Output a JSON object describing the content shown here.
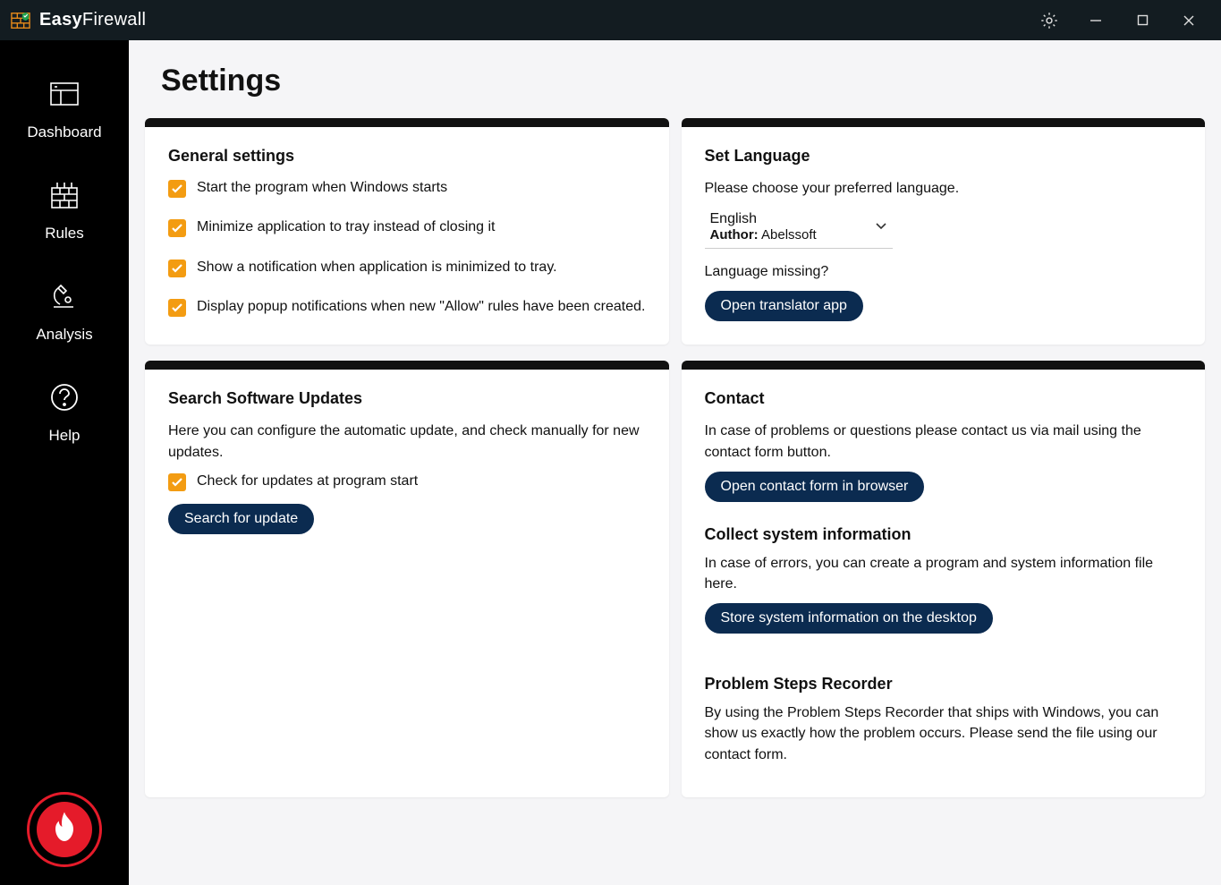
{
  "titlebar": {
    "app_name_bold": "Easy",
    "app_name_rest": "Firewall"
  },
  "sidebar": {
    "items": [
      {
        "label": "Dashboard"
      },
      {
        "label": "Rules"
      },
      {
        "label": "Analysis"
      },
      {
        "label": "Help"
      }
    ]
  },
  "page": {
    "title": "Settings"
  },
  "general": {
    "heading": "General settings",
    "opts": [
      "Start the program when Windows starts",
      "Minimize application to tray instead of closing it",
      "Show a notification when application is minimized to tray.",
      "Display popup notifications when new \"Allow\" rules have been created."
    ]
  },
  "language": {
    "heading": "Set Language",
    "instruction": "Please choose your preferred language.",
    "selected": "English",
    "author_label": "Author:",
    "author": "Abelssoft",
    "missing": "Language missing?",
    "translator_btn": "Open translator app"
  },
  "updates": {
    "heading": "Search Software Updates",
    "desc": "Here you can configure the automatic update, and check manually for new updates.",
    "opt": "Check for updates at program start",
    "search_btn": "Search for update"
  },
  "contact": {
    "heading": "Contact",
    "desc": "In case of problems or questions please contact us via mail using the contact form button.",
    "btn": "Open contact form in browser",
    "collect_heading": "Collect system information",
    "collect_desc": "In case of errors, you can create a program and system information file here.",
    "store_btn": "Store system information on the desktop",
    "psr_heading": "Problem Steps Recorder",
    "psr_desc": "By using the Problem Steps Recorder that ships with Windows, you can show us exactly how the problem occurs. Please send the file using our contact form."
  }
}
